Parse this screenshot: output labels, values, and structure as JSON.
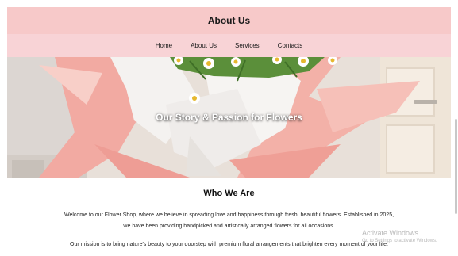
{
  "header": {
    "title": "About Us"
  },
  "nav": {
    "items": [
      {
        "label": "Home"
      },
      {
        "label": "About Us"
      },
      {
        "label": "Services"
      },
      {
        "label": "Contacts"
      }
    ]
  },
  "hero": {
    "title": "Our Story & Passion for Flowers",
    "colors": {
      "wrap_pink": "#f2a8a0",
      "wrap_white": "#f4f2f0",
      "wall": "#e9e2dc",
      "door": "#efe5d8"
    }
  },
  "about": {
    "heading": "Who We Are",
    "paragraph1_line1": "Welcome to our Flower Shop, where we believe in spreading love and happiness through fresh, beautiful flowers. Established in 2025,",
    "paragraph1_line2": "we have been providing handpicked and artistically arranged flowers for all occasions.",
    "paragraph2": "Our mission is to bring nature's beauty to your doorstep with premium floral arrangements that brighten every moment of your life."
  },
  "watermark": {
    "title": "Activate Windows",
    "subtitle": "Go to Settings to activate Windows."
  },
  "colors": {
    "header_bg": "#f7c9c9",
    "nav_bg": "#f8d3d6"
  }
}
